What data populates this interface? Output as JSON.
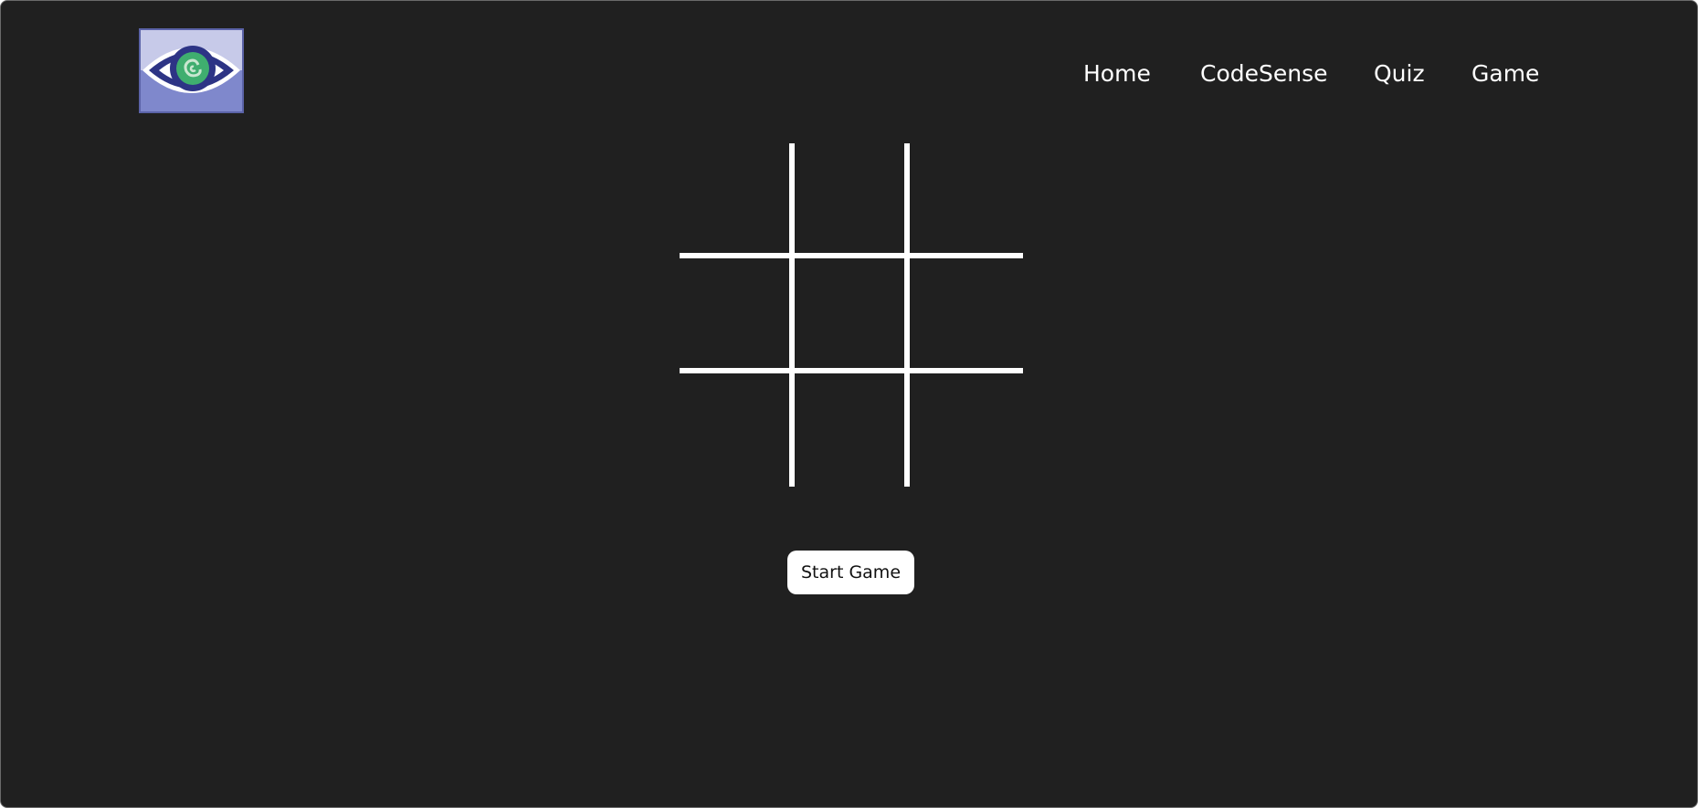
{
  "logo": {
    "icon": "eye-icon",
    "colors": {
      "frame": "#5b63a8",
      "background_top": "#c7cae9",
      "background_bottom": "#7f88cc",
      "eye_outline": "#2d3485",
      "iris": "#3fae6f",
      "swirl": "#c9e7d0"
    }
  },
  "nav": {
    "items": [
      {
        "label": "Home"
      },
      {
        "label": "CodeSense"
      },
      {
        "label": "Quiz"
      },
      {
        "label": "Game"
      }
    ]
  },
  "game": {
    "board": {
      "rows": 3,
      "cols": 3,
      "cells": [
        "",
        "",
        "",
        "",
        "",
        "",
        "",
        "",
        ""
      ]
    },
    "start_button_label": "Start Game"
  },
  "colors": {
    "page_background": "#202020",
    "text": "#ffffff",
    "grid_lines": "#ffffff",
    "button_background": "#ffffff",
    "button_text": "#111111"
  }
}
